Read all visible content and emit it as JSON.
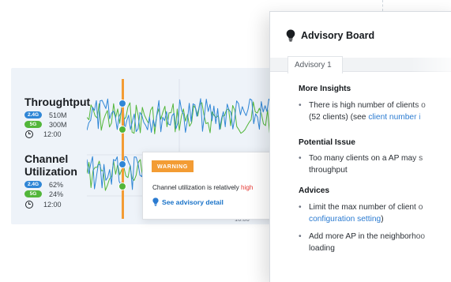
{
  "chart_panel": {
    "throughput": {
      "title": "Throughtput",
      "band24_label": "2.4G",
      "band24_value": "510M",
      "band5_label": "5G",
      "band5_value": "300M",
      "time": "12:00"
    },
    "utilization": {
      "title_line1": "Channel",
      "title_line2": "Utilization",
      "band24_label": "2.4G",
      "band24_value": "62%",
      "band5_label": "5G",
      "band5_value": "24%",
      "time": "12:00"
    },
    "time_tick": "16:00",
    "colors": {
      "band24": "#2f86d6",
      "band5": "#52b63a",
      "cursor": "#f39c34"
    }
  },
  "tooltip": {
    "badge": "WARNING",
    "text_prefix": "Channel utilization is relatively ",
    "text_highlight": "high",
    "link": "See advisory detail",
    "icon": "lightbulb-icon"
  },
  "advisory_board": {
    "title": "Advisory Board",
    "icon": "lightbulb-icon",
    "tabs": [
      "Advisory 1"
    ],
    "sections": [
      {
        "title": "More Insights",
        "bullets": [
          {
            "line1": "There is high number of clients o",
            "line2_prefix": "(52 clients) (see ",
            "line2_link": "client number i",
            "line2_suffix": ""
          }
        ]
      },
      {
        "title": "Potential Issue",
        "bullets": [
          {
            "line1": "Too many clients on a AP may s",
            "line2_prefix": "throughput",
            "line2_link": "",
            "line2_suffix": ""
          }
        ]
      },
      {
        "title": "Advices",
        "bullets": [
          {
            "line1": "Limit the max number of client o",
            "line2_prefix": "",
            "line2_link": "configuration setting",
            "line2_suffix": ")"
          },
          {
            "line1": "Add more AP in the neighborhoo",
            "line2_prefix": "loading",
            "line2_link": "",
            "line2_suffix": ""
          }
        ]
      }
    ]
  }
}
